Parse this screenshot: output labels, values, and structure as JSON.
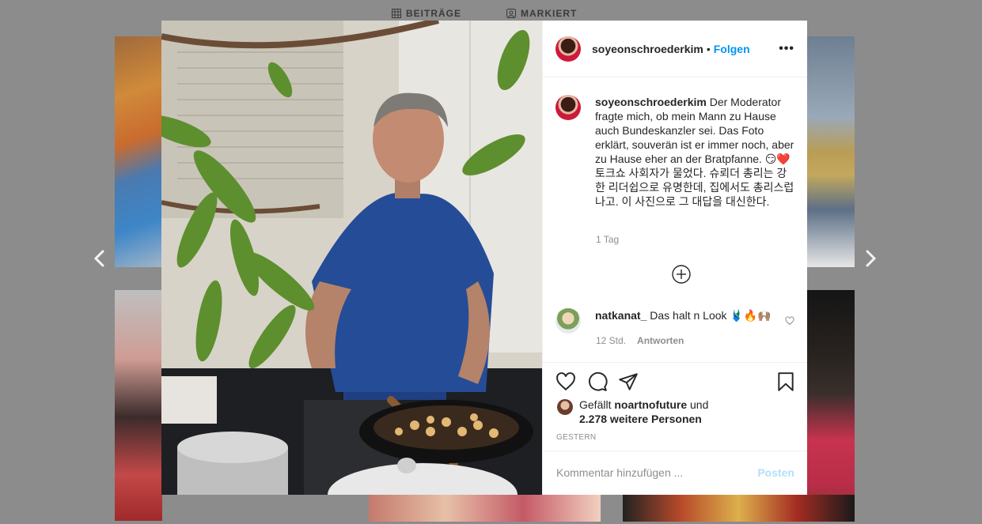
{
  "profile_tabs": {
    "posts": "BEITRÄGE",
    "tagged": "MARKIERT"
  },
  "post": {
    "username": "soyeonschroederkim",
    "follow_label": "Folgen",
    "dot": "•",
    "more_label": "•••",
    "caption_de": "Der Moderator fragte mich, ob mein Mann zu Hause auch Bundeskanzler sei. Das Foto erklärt, souverän ist er immer noch, aber zu Hause eher an der Bratpfanne. 😏❤️",
    "caption_ko": "토크쇼 사회자가 물었다. 슈뢰더 총리는 강한 리더쉽으로 유명한데, 집에서도 총리스럽나고. 이 사진으로 그 대답을 대신한다.",
    "caption_age": "1 Tag",
    "comment": {
      "username": "natkanat_",
      "text": "Das halt n Look 🩱🔥🙌🏽",
      "age": "12 Std.",
      "reply_label": "Antworten"
    },
    "likes": {
      "prefix": "Gefällt",
      "user": "noartnofuture",
      "conjunction": "und",
      "others": "2.278 weitere Personen"
    },
    "date": "GESTERN",
    "add_comment": {
      "placeholder": "Kommentar hinzufügen ...",
      "post_label": "Posten"
    }
  },
  "icons": [
    "grid-icon",
    "tag-icon",
    "chevron-left-icon",
    "chevron-right-icon",
    "more-icon",
    "load-more-icon",
    "heart-icon",
    "comment-icon",
    "share-icon",
    "save-icon"
  ]
}
